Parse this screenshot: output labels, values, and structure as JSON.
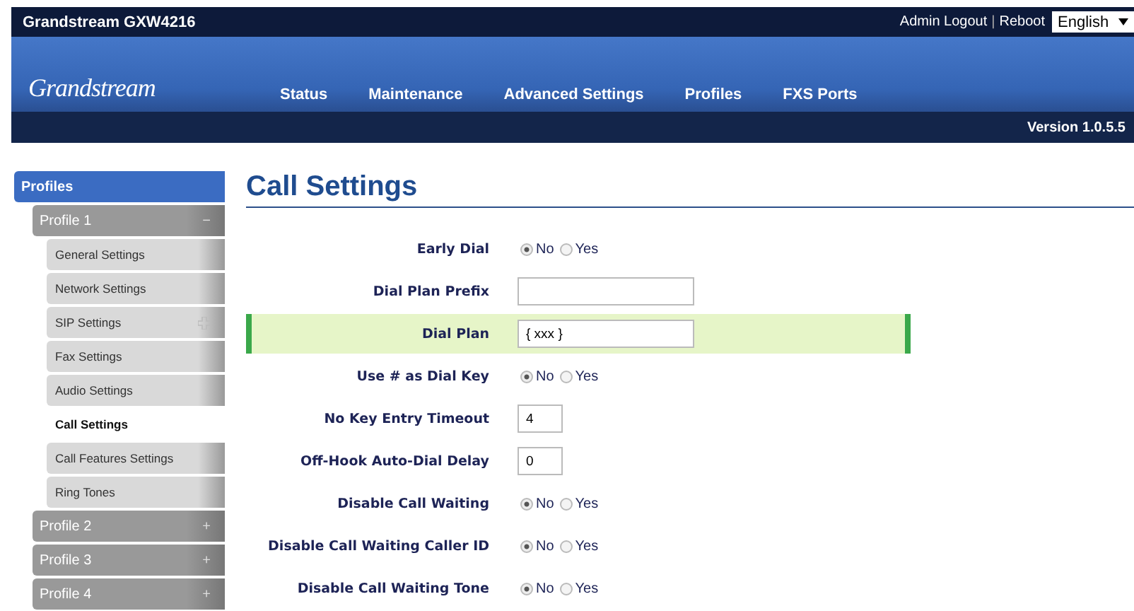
{
  "top_bar": {
    "title": "Grandstream GXW4216",
    "links": [
      "Admin Logout",
      "Reboot"
    ],
    "separator": "|",
    "language": "English"
  },
  "header": {
    "logo": "Grandstream",
    "nav": [
      "Status",
      "Maintenance",
      "Advanced Settings",
      "Profiles",
      "FXS Ports"
    ]
  },
  "version_bar": {
    "version": "Version 1.0.5.5"
  },
  "sidebar": {
    "title": "Profiles",
    "items": [
      {
        "label": "Profile 1",
        "toggle": "−",
        "children": [
          {
            "label": "General Settings",
            "selected": false
          },
          {
            "label": "Network Settings",
            "selected": false
          },
          {
            "label": "SIP Settings",
            "selected": false,
            "expandable": true
          },
          {
            "label": "Fax Settings",
            "selected": false
          },
          {
            "label": "Audio Settings",
            "selected": false
          },
          {
            "label": "Call Settings",
            "selected": true
          },
          {
            "label": "Call Features Settings",
            "selected": false
          },
          {
            "label": "Ring Tones",
            "selected": false
          }
        ]
      },
      {
        "label": "Profile 2",
        "toggle": "+"
      },
      {
        "label": "Profile 3",
        "toggle": "+"
      },
      {
        "label": "Profile 4",
        "toggle": "+"
      }
    ]
  },
  "page": {
    "title": "Call Settings",
    "fields": [
      {
        "kind": "radio",
        "label": "Early Dial",
        "highlighted": false,
        "options": [
          {
            "label": "No",
            "selected": true
          },
          {
            "label": "Yes",
            "selected": false
          }
        ]
      },
      {
        "kind": "text",
        "label": "Dial Plan Prefix",
        "highlighted": false
      },
      {
        "kind": "text",
        "label": "Dial Plan",
        "highlighted": true,
        "value": "{ xxx }"
      },
      {
        "kind": "radio",
        "label": "Use # as Dial Key",
        "highlighted": false,
        "options": [
          {
            "label": "No",
            "selected": true
          },
          {
            "label": "Yes",
            "selected": false
          }
        ]
      },
      {
        "kind": "number",
        "label": "No Key Entry Timeout",
        "highlighted": false,
        "value": "4"
      },
      {
        "kind": "number",
        "label": "Off-Hook Auto-Dial Delay",
        "highlighted": false,
        "value": "0"
      },
      {
        "kind": "radio",
        "label": "Disable Call Waiting",
        "highlighted": false,
        "options": [
          {
            "label": "No",
            "selected": true
          },
          {
            "label": "Yes",
            "selected": false
          }
        ]
      },
      {
        "kind": "radio",
        "label": "Disable Call Waiting Caller ID",
        "highlighted": false,
        "options": [
          {
            "label": "No",
            "selected": true
          },
          {
            "label": "Yes",
            "selected": false
          }
        ]
      },
      {
        "kind": "radio",
        "label": "Disable Call Waiting Tone",
        "highlighted": false,
        "options": [
          {
            "label": "No",
            "selected": true
          },
          {
            "label": "Yes",
            "selected": false
          }
        ]
      }
    ]
  }
}
